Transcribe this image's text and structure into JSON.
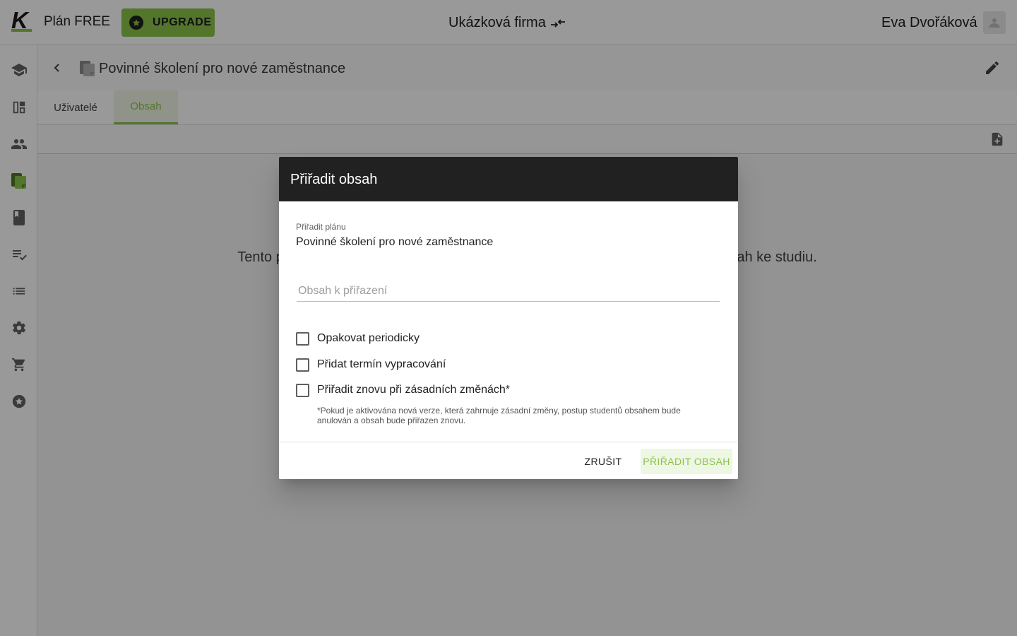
{
  "header": {
    "logo_letter": "K",
    "plan_label": "Plán FREE",
    "upgrade_label": "UPGRADE",
    "company_name": "Ukázková firma",
    "user_name": "Eva Dvořáková"
  },
  "sidebar": {
    "items": [
      {
        "icon": "graduation-cap-icon",
        "active": false
      },
      {
        "icon": "dashboard-icon",
        "active": false
      },
      {
        "icon": "people-icon",
        "active": false
      },
      {
        "icon": "content-plans-icon",
        "active": true
      },
      {
        "icon": "book-icon",
        "active": false
      },
      {
        "icon": "playlist-check-icon",
        "active": false
      },
      {
        "icon": "list-icon",
        "active": false
      },
      {
        "icon": "settings-icon",
        "active": false
      },
      {
        "icon": "shopping-cart-icon",
        "active": false
      },
      {
        "icon": "star-badge-icon",
        "active": false
      }
    ]
  },
  "plan": {
    "title": "Povinné školení pro nové zaměstnance"
  },
  "tabs": [
    {
      "label": "Uživatelé",
      "active": false
    },
    {
      "label": "Obsah",
      "active": true
    }
  ],
  "empty_state": {
    "text": "Tento plán nemá přiřazen žádný obsah. Klikněte na tlačítko a přiřaďte plánu obsah ke studiu."
  },
  "dialog": {
    "title": "Přiřadit obsah",
    "plan_field_label": "Přiřadit plánu",
    "plan_field_value": "Povinné školení pro nové zaměstnance",
    "content_placeholder": "Obsah k přiřazení",
    "content_value": "",
    "checkboxes": [
      {
        "label": "Opakovat periodicky",
        "checked": false
      },
      {
        "label": "Přidat termín vypracování",
        "checked": false
      },
      {
        "label": "Přiřadit znovu při zásadních změnách*",
        "checked": false
      }
    ],
    "hint": "*Pokud je aktivována nová verze, která zahrnuje zásadní změny, postup studentů obsahem bude anulován a obsah bude přiřazen znovu.",
    "cancel_label": "ZRUŠIT",
    "assign_label": "PŘIŘADIT OBSAH"
  },
  "colors": {
    "accent": "#8bc34a",
    "dialog_header": "#212121",
    "overlay": "rgba(0,0,0,0.40)"
  }
}
